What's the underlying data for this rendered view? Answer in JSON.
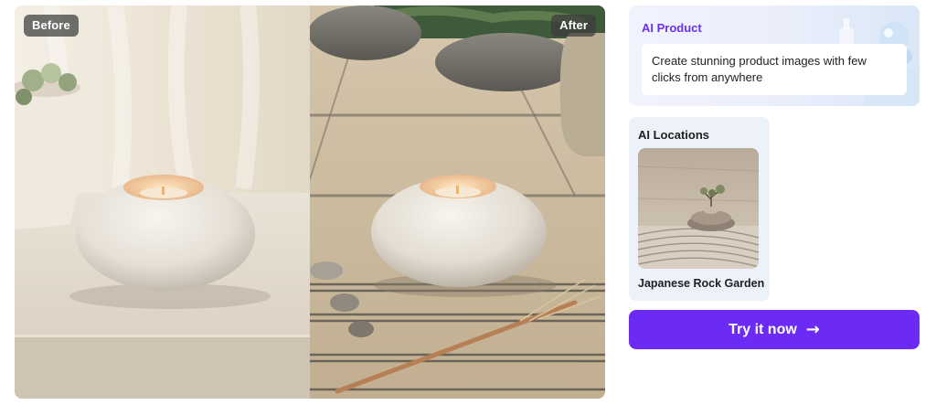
{
  "comparison": {
    "before_label": "Before",
    "after_label": "After",
    "before_image": "candle holder on white windowsill",
    "after_image": "candle holder in zen sand garden"
  },
  "product_card": {
    "title": "AI Product",
    "description": "Create stunning product images with few clicks from anywhere"
  },
  "location_card": {
    "title": "AI Locations",
    "thumbnail": "japanese rock garden scene",
    "caption": "Japanese Rock Garden"
  },
  "cta": {
    "label": "Try it now",
    "icon": "arrow-right-icon"
  },
  "colors": {
    "accent": "#6c2bf5",
    "accent_text": "#6b30ee",
    "card_bg": "#edf1fa",
    "badge_bg": "#3c3c3c"
  }
}
